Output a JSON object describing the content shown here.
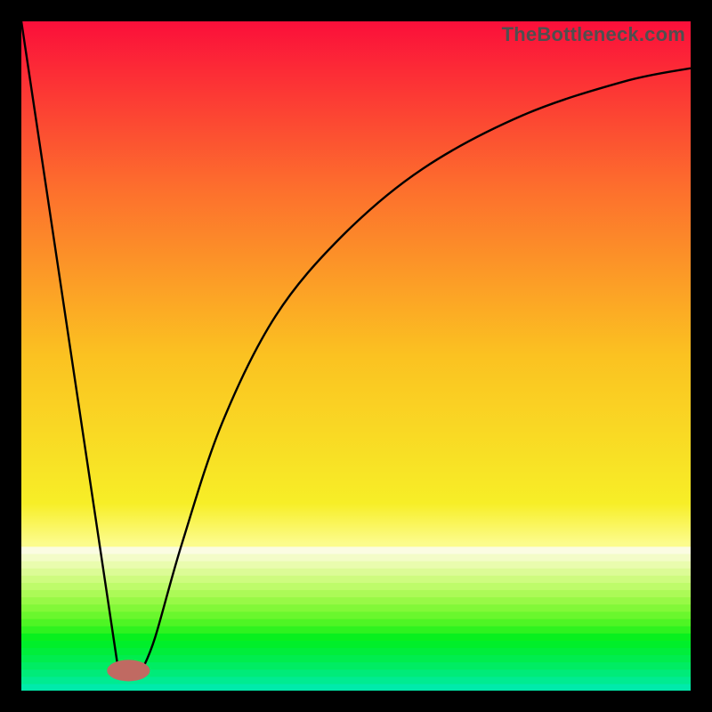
{
  "watermark": "TheBottleneck.com",
  "chart_data": {
    "type": "line",
    "title": "",
    "xlabel": "",
    "ylabel": "",
    "xlim": [
      0,
      100
    ],
    "ylim": [
      0,
      100
    ],
    "grid": false,
    "series": [
      {
        "name": "left-slope",
        "x": [
          0,
          14.5
        ],
        "values": [
          100,
          3
        ]
      },
      {
        "name": "right-curve",
        "x": [
          18,
          20,
          24,
          30,
          38,
          48,
          60,
          75,
          90,
          100
        ],
        "values": [
          3,
          8,
          22,
          40,
          56,
          68,
          78,
          86,
          91,
          93
        ]
      }
    ],
    "marker": {
      "name": "bottom-pill",
      "x": 16,
      "y": 3,
      "rx": 3.2,
      "ry": 1.6,
      "color": "#c06a62"
    },
    "gradient_background": {
      "top_colors": [
        {
          "offset": 0.0,
          "color": "#fb0f3a"
        },
        {
          "offset": 0.25,
          "color": "#fd6f2d"
        },
        {
          "offset": 0.5,
          "color": "#fbc221"
        },
        {
          "offset": 0.72,
          "color": "#f7ee27"
        },
        {
          "offset": 0.78,
          "color": "#fcfc8c"
        }
      ],
      "band_start": 0.785,
      "bands": [
        "#fbfce2",
        "#f3fcc8",
        "#e9fcae",
        "#dcfb96",
        "#cefb7f",
        "#befb6a",
        "#acfa57",
        "#98f946",
        "#82f838",
        "#6af72d",
        "#4ff524",
        "#2ff31f",
        "#08f01e",
        "#00ef2a",
        "#00ee3b",
        "#00ed4e",
        "#00ec63",
        "#00eb79",
        "#00eb91",
        "#00eaab"
      ],
      "band_height_frac": 0.0108
    }
  }
}
